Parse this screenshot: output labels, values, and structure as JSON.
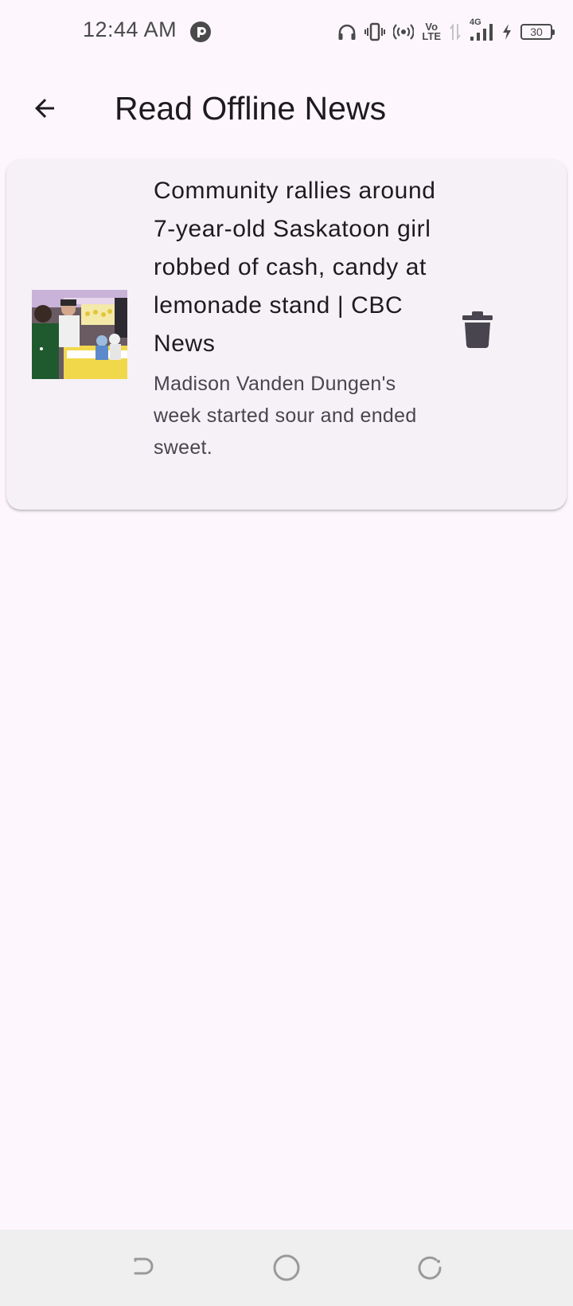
{
  "status_bar": {
    "time": "12:44 AM",
    "app_icon": "cloud-sync-icon",
    "icons": [
      "headphones-icon",
      "vibrate-icon",
      "hotspot-icon",
      "volte-icon",
      "data-arrows-icon",
      "signal-4g-icon",
      "charging-icon"
    ],
    "volte_top": "Vo",
    "volte_bottom": "LTE",
    "network_type": "4G",
    "battery_level": "30"
  },
  "app_bar": {
    "back_icon": "arrow-back-icon",
    "title": "Read Offline News"
  },
  "news_list": [
    {
      "title": "Community rallies around 7-year-old Saskatoon girl robbed of cash, candy at lemonade stand | CBC News",
      "description": "Madison Vanden Dungen's week started sour and ended sweet.",
      "thumbnail": "news-photo-lemonade-stand",
      "delete_icon": "trash-icon"
    }
  ],
  "nav_bar": {
    "back": "nav-back-icon",
    "home": "nav-home-icon",
    "recents": "nav-recents-icon"
  },
  "colors": {
    "background": "#fdf7fd",
    "card": "#f5f1f7",
    "title_text": "#1d1b20",
    "secondary_text": "#49454f",
    "nav_bar": "#efefef"
  }
}
